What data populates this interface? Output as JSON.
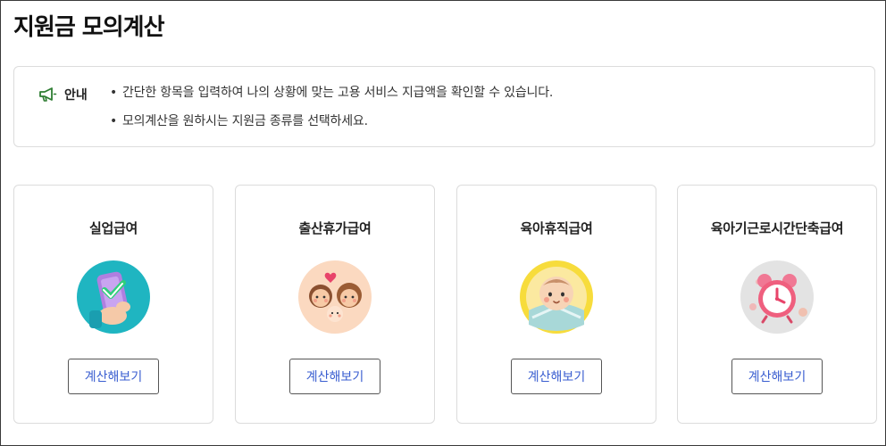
{
  "page": {
    "title": "지원금 모의계산"
  },
  "notice": {
    "label": "안내",
    "icon": "megaphone-icon",
    "icon_color": "#2e7d32",
    "bullet": "•",
    "lines": [
      "간단한 항목을 입력하여 나의 상황에 맞는 고용 서비스 지급액을 확인할 수 있습니다.",
      "모의계산을 원하시는 지원금 종류를 선택하세요."
    ]
  },
  "cards": [
    {
      "title": "실업급여",
      "icon": "phone-check-icon",
      "icon_bg": "#1fb5c1",
      "button": "계산해보기"
    },
    {
      "title": "출산휴가급여",
      "icon": "family-icon",
      "icon_bg": "#fbd9c0",
      "button": "계산해보기"
    },
    {
      "title": "육아휴직급여",
      "icon": "baby-icon",
      "icon_bg": "#f7dc3c",
      "button": "계산해보기"
    },
    {
      "title": "육아기근로시간단축급여",
      "icon": "alarm-clock-icon",
      "icon_bg": "#e3e3e3",
      "button": "계산해보기"
    }
  ],
  "colors": {
    "button_text": "#3a5ed0",
    "border": "#dcdcdc"
  }
}
